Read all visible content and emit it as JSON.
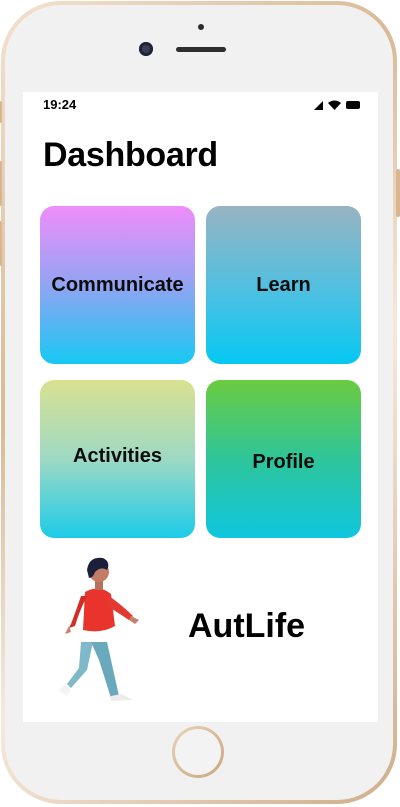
{
  "status_bar": {
    "time": "19:24"
  },
  "header": {
    "title": "Dashboard"
  },
  "tiles": [
    {
      "label": "Communicate"
    },
    {
      "label": "Learn"
    },
    {
      "label": "Activities"
    },
    {
      "label": "Profile"
    }
  ],
  "footer": {
    "brand": "AutLife"
  },
  "colors": {
    "communicate_top": "#ef8dfa",
    "communicate_bottom": "#17c8f2",
    "learn_top": "#98b3c2",
    "learn_bottom": "#05c8f2",
    "activities_top": "#d9e190",
    "activities_bottom": "#1ccbe8",
    "profile_top": "#6bcb3f",
    "profile_bottom": "#0fc6df"
  },
  "icons": [
    "signal-icon",
    "wifi-icon",
    "battery-icon",
    "walking-person-illustration"
  ]
}
